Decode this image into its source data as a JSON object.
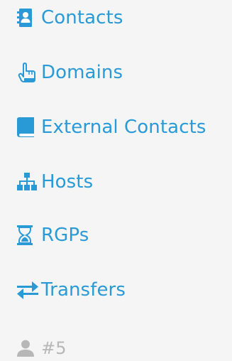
{
  "colors": {
    "link": "#2a9ad6",
    "muted": "#b7b7b7",
    "background": "#f5f5f5"
  },
  "menu": {
    "items": [
      {
        "label": "Contacts",
        "icon": "address-book-icon"
      },
      {
        "label": "Domains",
        "icon": "hand-pointer-icon"
      },
      {
        "label": "External Contacts",
        "icon": "book-icon"
      },
      {
        "label": "Hosts",
        "icon": "sitemap-icon"
      },
      {
        "label": "RGPs",
        "icon": "hourglass-icon"
      },
      {
        "label": "Transfers",
        "icon": "exchange-arrows-icon"
      }
    ],
    "user": {
      "label": "#5",
      "icon": "user-icon"
    }
  }
}
